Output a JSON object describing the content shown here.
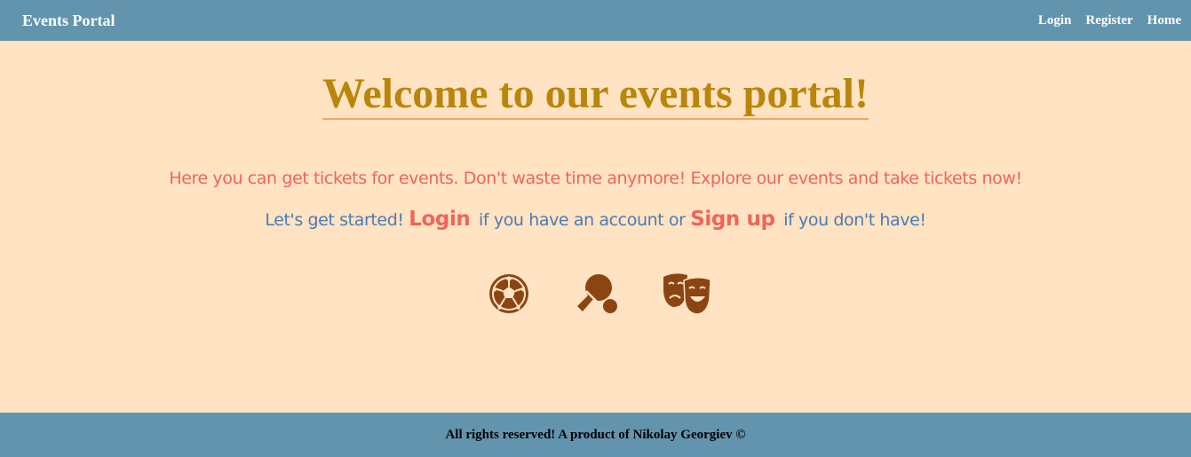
{
  "navbar": {
    "brand": "Events Portal",
    "links": [
      "Login",
      "Register",
      "Home"
    ]
  },
  "main": {
    "title": "Welcome to our events portal!",
    "intro": "Here you can get tickets for events. Don't waste time anymore! Explore our events and take tickets now!",
    "cta": {
      "prefix": "Let's get started!",
      "login_label": "Login",
      "middle": "if you have an account or",
      "signup_label": "Sign up",
      "suffix": "if you don't have!"
    },
    "icons": [
      "soccer-ball-icon",
      "ping-pong-paddle-icon",
      "theater-masks-icon"
    ]
  },
  "footer": {
    "text": "All rights reserved! A product of Nikolay Georgiev ©"
  },
  "colors": {
    "navbar_bg": "#6394ad",
    "page_bg": "#ffe3c2",
    "title": "#b8860b",
    "title_underline": "#f4a460",
    "accent": "#f0645a",
    "cta_text": "#4b7bb5",
    "icon": "#8b4513"
  }
}
